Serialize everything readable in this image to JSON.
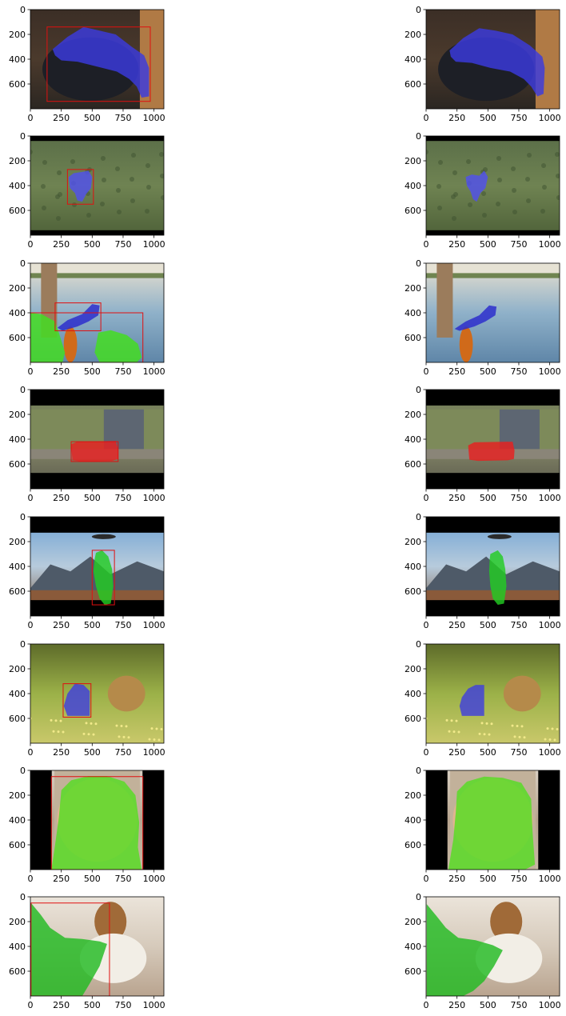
{
  "chart_data": {
    "type": "image-grid",
    "rows": 8,
    "cols": 2,
    "xlim": [
      0,
      1080
    ],
    "ylim": [
      800,
      0
    ],
    "xticks": [
      0,
      250,
      500,
      750,
      1000
    ],
    "yticks": [
      0,
      200,
      400,
      600
    ],
    "panels": [
      {
        "row": 0,
        "scene": "cat on chair",
        "mask_color": "#3a3adf",
        "boxes": [
          [
            135,
            140,
            970,
            740
          ]
        ],
        "left_mask": [
          [
            180,
            320
          ],
          [
            300,
            220
          ],
          [
            430,
            140
          ],
          [
            560,
            170
          ],
          [
            690,
            200
          ],
          [
            820,
            300
          ],
          [
            920,
            370
          ],
          [
            960,
            470
          ],
          [
            960,
            700
          ],
          [
            900,
            710
          ],
          [
            860,
            620
          ],
          [
            800,
            560
          ],
          [
            700,
            500
          ],
          [
            540,
            460
          ],
          [
            380,
            420
          ],
          [
            250,
            410
          ],
          [
            200,
            370
          ]
        ],
        "right_mask": [
          [
            190,
            330
          ],
          [
            300,
            230
          ],
          [
            430,
            150
          ],
          [
            560,
            170
          ],
          [
            700,
            200
          ],
          [
            840,
            290
          ],
          [
            940,
            380
          ],
          [
            960,
            470
          ],
          [
            950,
            680
          ],
          [
            900,
            700
          ],
          [
            850,
            620
          ],
          [
            790,
            560
          ],
          [
            680,
            500
          ],
          [
            520,
            470
          ],
          [
            370,
            430
          ],
          [
            240,
            420
          ],
          [
            200,
            380
          ]
        ]
      },
      {
        "row": 1,
        "scene": "rooster in field",
        "mask_color": "#5050ee",
        "boxes": [
          [
            300,
            270,
            510,
            550
          ]
        ],
        "left_mask": [
          [
            310,
            330
          ],
          [
            350,
            300
          ],
          [
            420,
            290
          ],
          [
            470,
            280
          ],
          [
            500,
            330
          ],
          [
            490,
            420
          ],
          [
            450,
            470
          ],
          [
            420,
            530
          ],
          [
            380,
            520
          ],
          [
            360,
            460
          ],
          [
            320,
            420
          ]
        ],
        "right_mask": [
          [
            320,
            330
          ],
          [
            370,
            310
          ],
          [
            430,
            320
          ],
          [
            470,
            280
          ],
          [
            500,
            330
          ],
          [
            480,
            420
          ],
          [
            440,
            460
          ],
          [
            410,
            530
          ],
          [
            380,
            510
          ],
          [
            360,
            450
          ],
          [
            330,
            400
          ]
        ]
      },
      {
        "row": 2,
        "scene": "hands with bird toy by lake",
        "mask_color": "#2a2acd",
        "boxes": [
          [
            200,
            320,
            570,
            545
          ],
          [
            0,
            400,
            910,
            800
          ]
        ],
        "left_mask": [
          [
            220,
            520
          ],
          [
            300,
            460
          ],
          [
            420,
            410
          ],
          [
            500,
            330
          ],
          [
            560,
            340
          ],
          [
            550,
            420
          ],
          [
            470,
            470
          ],
          [
            380,
            510
          ],
          [
            260,
            545
          ]
        ],
        "right_mask": [
          [
            230,
            530
          ],
          [
            320,
            470
          ],
          [
            430,
            420
          ],
          [
            510,
            340
          ],
          [
            570,
            350
          ],
          [
            560,
            420
          ],
          [
            480,
            470
          ],
          [
            390,
            510
          ],
          [
            270,
            545
          ]
        ],
        "secondary_masks": [
          {
            "color": "#44dd22",
            "points": [
              [
                0,
                400
              ],
              [
                90,
                410
              ],
              [
                200,
                470
              ],
              [
                230,
                560
              ],
              [
                280,
                720
              ],
              [
                260,
                800
              ],
              [
                0,
                800
              ]
            ]
          },
          {
            "color": "#44dd22",
            "points": [
              [
                550,
                560
              ],
              [
                650,
                540
              ],
              [
                780,
                580
              ],
              [
                870,
                650
              ],
              [
                900,
                760
              ],
              [
                860,
                800
              ],
              [
                560,
                800
              ],
              [
                520,
                720
              ]
            ]
          }
        ]
      },
      {
        "row": 3,
        "scene": "red bus on road",
        "mask_color": "#e82020",
        "boxes": [
          [
            330,
            420,
            710,
            580
          ]
        ],
        "left_mask": [
          [
            330,
            440
          ],
          [
            380,
            420
          ],
          [
            690,
            415
          ],
          [
            710,
            480
          ],
          [
            710,
            560
          ],
          [
            660,
            575
          ],
          [
            420,
            580
          ],
          [
            340,
            570
          ]
        ],
        "right_mask": [
          [
            340,
            450
          ],
          [
            390,
            425
          ],
          [
            700,
            420
          ],
          [
            715,
            490
          ],
          [
            710,
            560
          ],
          [
            660,
            570
          ],
          [
            420,
            575
          ],
          [
            350,
            565
          ]
        ]
      },
      {
        "row": 4,
        "scene": "person with kite in mountains",
        "mask_color": "#22cc22",
        "boxes": [
          [
            500,
            270,
            680,
            710
          ]
        ],
        "left_mask": [
          [
            530,
            290
          ],
          [
            580,
            270
          ],
          [
            630,
            320
          ],
          [
            660,
            420
          ],
          [
            670,
            560
          ],
          [
            650,
            700
          ],
          [
            600,
            710
          ],
          [
            560,
            660
          ],
          [
            530,
            560
          ],
          [
            510,
            440
          ],
          [
            520,
            340
          ]
        ],
        "right_mask": [
          [
            520,
            300
          ],
          [
            580,
            270
          ],
          [
            620,
            320
          ],
          [
            640,
            420
          ],
          [
            650,
            560
          ],
          [
            630,
            700
          ],
          [
            580,
            710
          ],
          [
            540,
            660
          ],
          [
            520,
            560
          ],
          [
            510,
            440
          ],
          [
            515,
            340
          ]
        ]
      },
      {
        "row": 5,
        "scene": "puppy in grass",
        "mask_color": "#4040dd",
        "boxes": [
          [
            265,
            320,
            490,
            590
          ]
        ],
        "left_mask": [
          [
            300,
            400
          ],
          [
            360,
            320
          ],
          [
            430,
            330
          ],
          [
            480,
            380
          ],
          [
            480,
            580
          ],
          [
            300,
            580
          ],
          [
            270,
            500
          ]
        ],
        "right_mask": [
          [
            290,
            430
          ],
          [
            340,
            360
          ],
          [
            400,
            330
          ],
          [
            470,
            330
          ],
          [
            470,
            580
          ],
          [
            290,
            580
          ],
          [
            270,
            500
          ]
        ]
      },
      {
        "row": 6,
        "scene": "smiling girl portrait",
        "mask_color": "#55dd22",
        "boxes": [
          [
            170,
            50,
            910,
            800
          ]
        ],
        "left_mask": [
          [
            250,
            160
          ],
          [
            330,
            80
          ],
          [
            470,
            45
          ],
          [
            620,
            45
          ],
          [
            760,
            90
          ],
          [
            850,
            200
          ],
          [
            880,
            420
          ],
          [
            870,
            620
          ],
          [
            900,
            800
          ],
          [
            170,
            800
          ],
          [
            200,
            600
          ],
          [
            230,
            380
          ]
        ],
        "right_mask": [
          [
            250,
            170
          ],
          [
            330,
            90
          ],
          [
            470,
            50
          ],
          [
            620,
            60
          ],
          [
            770,
            100
          ],
          [
            850,
            230
          ],
          [
            860,
            480
          ],
          [
            880,
            760
          ],
          [
            800,
            800
          ],
          [
            180,
            800
          ],
          [
            220,
            560
          ],
          [
            240,
            340
          ]
        ]
      },
      {
        "row": 7,
        "scene": "beagle puppy",
        "mask_color": "#22bb22",
        "boxes": [
          [
            5,
            50,
            640,
            800
          ]
        ],
        "left_mask": [
          [
            5,
            50
          ],
          [
            80,
            140
          ],
          [
            160,
            250
          ],
          [
            280,
            330
          ],
          [
            420,
            340
          ],
          [
            560,
            360
          ],
          [
            620,
            380
          ],
          [
            560,
            560
          ],
          [
            480,
            700
          ],
          [
            420,
            800
          ],
          [
            5,
            800
          ]
        ],
        "right_mask": [
          [
            5,
            60
          ],
          [
            80,
            150
          ],
          [
            160,
            250
          ],
          [
            260,
            330
          ],
          [
            400,
            350
          ],
          [
            540,
            390
          ],
          [
            620,
            430
          ],
          [
            550,
            560
          ],
          [
            470,
            680
          ],
          [
            380,
            760
          ],
          [
            300,
            800
          ],
          [
            5,
            800
          ]
        ]
      }
    ]
  }
}
